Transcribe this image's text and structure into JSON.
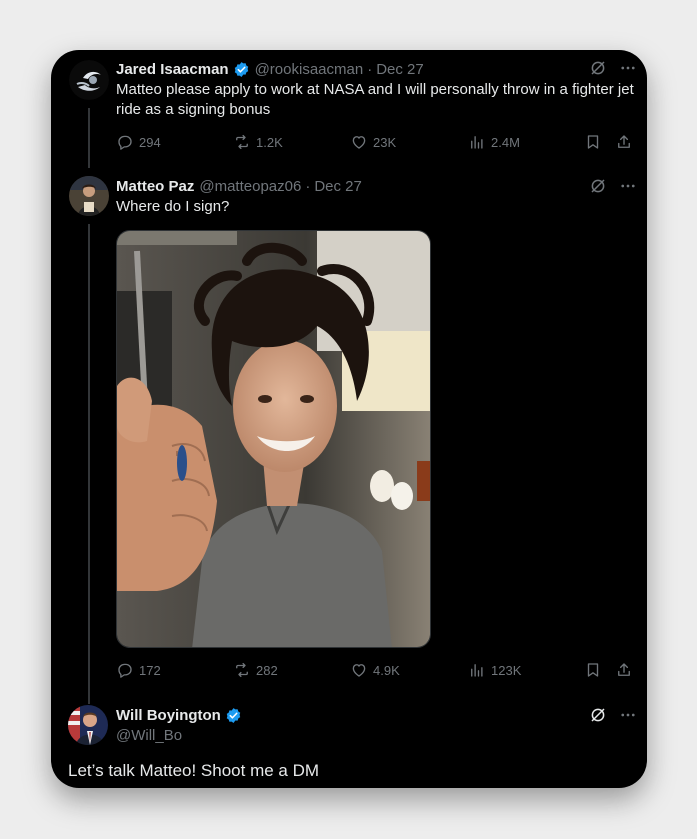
{
  "tweets": [
    {
      "name": "Jared Isaacman",
      "handle": "@rookisaacman",
      "date": "Dec 27",
      "text": "Matteo please apply to work at NASA and I will personally throw in a fighter jet ride as a signing bonus",
      "stats": {
        "replies": "294",
        "reposts": "1.2K",
        "likes": "23K",
        "views": "2.4M"
      }
    },
    {
      "name": "Matteo Paz",
      "handle": "@matteopaz06",
      "date": "Dec 27",
      "text": "Where do I sign?",
      "stats": {
        "replies": "172",
        "reposts": "282",
        "likes": "4.9K",
        "views": "123K"
      }
    },
    {
      "name": "Will Boyington",
      "handle": "@Will_Bo",
      "text": "Let’s talk Matteo! Shoot me a DM"
    }
  ],
  "colors": {
    "verified": "#1d9bf0",
    "muted": "#71767b",
    "background": "#000000"
  },
  "icons": [
    "grok-icon",
    "more-icon",
    "reply-icon",
    "repost-icon",
    "like-icon",
    "views-icon",
    "bookmark-icon",
    "share-icon",
    "verified-badge-icon"
  ]
}
